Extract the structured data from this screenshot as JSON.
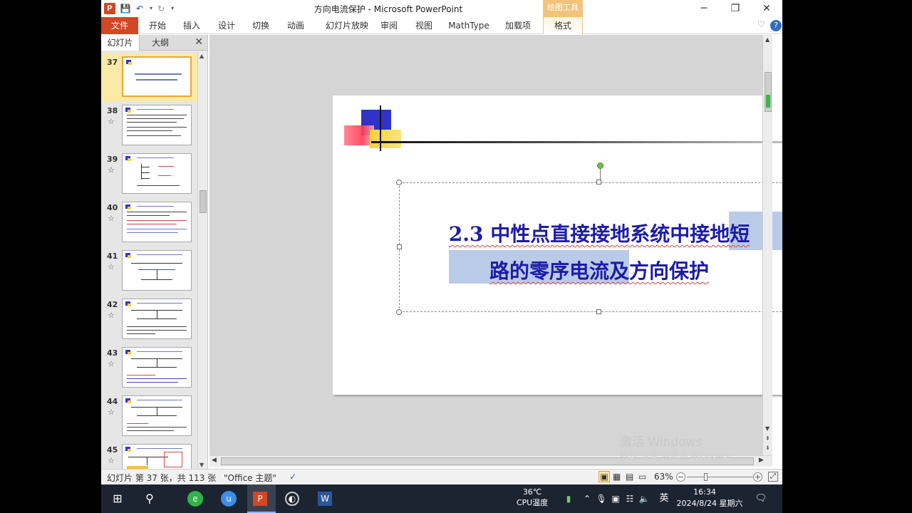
{
  "window": {
    "title": "方向电流保护 - Microsoft PowerPoint",
    "context_tab_group": "绘图工具",
    "minimize": "─",
    "restore": "❐",
    "close": "✕"
  },
  "ribbon": {
    "tabs": [
      "文件",
      "开始",
      "插入",
      "设计",
      "切换",
      "动画",
      "幻灯片放映",
      "审阅",
      "视图",
      "MathType",
      "加载项",
      "格式"
    ],
    "help_icon": "?"
  },
  "slides_panel": {
    "tab_slides": "幻灯片",
    "tab_outline": "大纲",
    "close": "✕",
    "thumbnails": [
      {
        "number": "37",
        "star": ""
      },
      {
        "number": "38",
        "star": "☆"
      },
      {
        "number": "39",
        "star": "☆"
      },
      {
        "number": "40",
        "star": "☆"
      },
      {
        "number": "41",
        "star": "☆"
      },
      {
        "number": "42",
        "star": "☆"
      },
      {
        "number": "43",
        "star": "☆"
      },
      {
        "number": "44",
        "star": "☆"
      },
      {
        "number": "45",
        "star": "☆"
      }
    ]
  },
  "slide": {
    "title_line1_plain": "2.3 中性点直接接地系统中接",
    "title_line1_selected": "地短",
    "title_line2_selected": "路的零序电流",
    "title_line2_plain": "及方向保护"
  },
  "watermark": {
    "line1": "激活 Windows",
    "line2": "转到\"设置\"以激活 Windows。"
  },
  "status": {
    "slide_info": "幻灯片 第 37 张，共 113 张",
    "theme": "\"Office 主题\"",
    "zoom": "63%"
  },
  "taskbar": {
    "temperature": "36℃",
    "cpu_label": "CPU温度",
    "ime": "英",
    "time": "16:34",
    "date": "2024/8/24 星期六"
  }
}
